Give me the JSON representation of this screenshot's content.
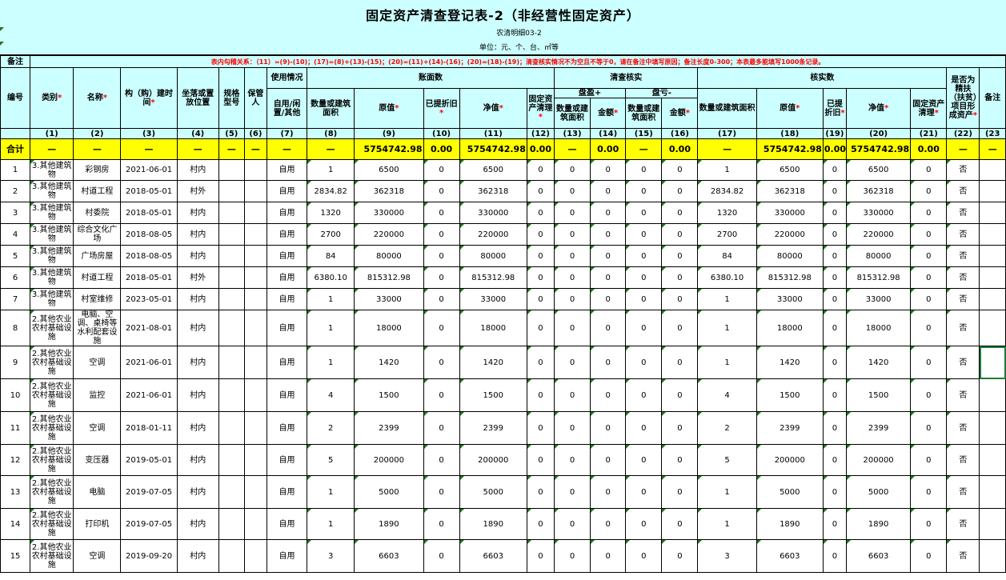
{
  "title": "固定资产清查登记表-2（非经营性固定资产）",
  "subcode": "农清明细03-2",
  "unit": "单位：元、个、台、㎡等",
  "note_label": "备注",
  "note_text": "表内勾稽关系：（11）=(9)-(10)；(17)=(8)+(13)-(15)；(20)=(11)+(14)-(16)；(20)=(18)-(19)；清查核实情况不为空且不等于0，请在备注中填写原因；备注长度0-300；本表最多能填写1000条记录。",
  "headers": {
    "no": "编号",
    "category": "类别",
    "name": "名称",
    "build_time": "构（购）建时间",
    "location": "坐落或置放位置",
    "spec": "规格型号",
    "keeper": "保管人",
    "usage_group": "使用情况",
    "usage": "自用/闲置/其他",
    "book_group": "账面数",
    "book_qty": "数量或建筑面积",
    "book_orig": "原值",
    "book_dep": "已提折旧",
    "book_net": "净值",
    "book_clear": "固定资产清理",
    "check_group": "清查核实",
    "surplus_group": "盘盈+",
    "surplus_qty": "数量或建筑面积",
    "surplus_amt": "金额",
    "loss_group": "盘亏-",
    "loss_qty": "数量或建筑面积",
    "loss_amt": "金额",
    "verified_group": "核实数",
    "ver_qty": "数量或建筑面积",
    "ver_orig": "原值",
    "ver_dep": "已提折旧",
    "ver_net": "净值",
    "ver_clear": "固定资产清理",
    "poverty": "是否为精扶（扶贫）项目形成资产",
    "remark": "备注"
  },
  "col_numbers": [
    "(1)",
    "(2)",
    "(3)",
    "(4)",
    "(5)",
    "(6)",
    "(7)",
    "(8)",
    "(9)",
    "(10)",
    "(11)",
    "(12)",
    "(13)",
    "(14)",
    "(15)",
    "(16)",
    "(17)",
    "(18)",
    "(19)",
    "(20)",
    "(21)",
    "(22)",
    "(23"
  ],
  "total": {
    "label": "合计",
    "dash": "—",
    "book_orig": "5754742.98",
    "book_dep": "0.00",
    "book_net": "5754742.98",
    "book_clear": "0.00",
    "surplus_amt": "0.00",
    "loss_amt": "0.00",
    "ver_orig": "5754742.98",
    "ver_dep": "0.00",
    "ver_net": "5754742.98",
    "ver_clear": "0.00"
  },
  "rows": [
    {
      "no": "1",
      "cat": "3.其他建筑物",
      "name": "彩钢房",
      "time": "2021-06-01",
      "loc": "村内",
      "usage": "自用",
      "qty": "1",
      "orig": "6500",
      "dep": "0",
      "net": "6500",
      "clear": "0",
      "sq": "0",
      "sa": "0",
      "lq": "0",
      "la": "0",
      "vq": "1",
      "vo": "6500",
      "vd": "0",
      "vn": "6500",
      "vc": "0",
      "pov": "否"
    },
    {
      "no": "2",
      "cat": "3.其他建筑物",
      "name": "村道工程",
      "time": "2018-05-01",
      "loc": "村外",
      "usage": "自用",
      "qty": "2834.82",
      "orig": "362318",
      "dep": "0",
      "net": "362318",
      "clear": "0",
      "sq": "0",
      "sa": "0",
      "lq": "0",
      "la": "0",
      "vq": "2834.82",
      "vo": "362318",
      "vd": "0",
      "vn": "362318",
      "vc": "0",
      "pov": "否"
    },
    {
      "no": "3",
      "cat": "3.其他建筑物",
      "name": "村委院",
      "time": "2018-05-01",
      "loc": "村内",
      "usage": "自用",
      "qty": "1320",
      "orig": "330000",
      "dep": "0",
      "net": "330000",
      "clear": "0",
      "sq": "0",
      "sa": "0",
      "lq": "0",
      "la": "0",
      "vq": "1320",
      "vo": "330000",
      "vd": "0",
      "vn": "330000",
      "vc": "0",
      "pov": "否"
    },
    {
      "no": "4",
      "cat": "3.其他建筑物",
      "name": "综合文化广场",
      "time": "2018-08-05",
      "loc": "村内",
      "usage": "自用",
      "qty": "2700",
      "orig": "220000",
      "dep": "0",
      "net": "220000",
      "clear": "0",
      "sq": "0",
      "sa": "0",
      "lq": "0",
      "la": "0",
      "vq": "2700",
      "vo": "220000",
      "vd": "0",
      "vn": "220000",
      "vc": "0",
      "pov": "否"
    },
    {
      "no": "5",
      "cat": "3.其他建筑物",
      "name": "广场房屋",
      "time": "2018-08-05",
      "loc": "村内",
      "usage": "自用",
      "qty": "84",
      "orig": "80000",
      "dep": "0",
      "net": "80000",
      "clear": "0",
      "sq": "0",
      "sa": "0",
      "lq": "0",
      "la": "0",
      "vq": "84",
      "vo": "80000",
      "vd": "0",
      "vn": "80000",
      "vc": "0",
      "pov": "否"
    },
    {
      "no": "6",
      "cat": "3.其他建筑物",
      "name": "村道工程",
      "time": "2018-05-01",
      "loc": "村外",
      "usage": "自用",
      "qty": "6380.10",
      "orig": "815312.98",
      "dep": "0",
      "net": "815312.98",
      "clear": "0",
      "sq": "0",
      "sa": "0",
      "lq": "0",
      "la": "0",
      "vq": "6380.10",
      "vo": "815312.98",
      "vd": "0",
      "vn": "815312.98",
      "vc": "0",
      "pov": "否"
    },
    {
      "no": "7",
      "cat": "3.其他建筑物",
      "name": "村室维修",
      "time": "2023-05-01",
      "loc": "村内",
      "usage": "自用",
      "qty": "1",
      "orig": "33000",
      "dep": "0",
      "net": "33000",
      "clear": "0",
      "sq": "0",
      "sa": "0",
      "lq": "0",
      "la": "0",
      "vq": "1",
      "vo": "33000",
      "vd": "0",
      "vn": "33000",
      "vc": "0",
      "pov": "否"
    },
    {
      "no": "8",
      "cat": "2.其他农业农村基础设施",
      "name": "电脑、空调、桌椅等水利配套设施",
      "time": "2021-08-01",
      "loc": "村内",
      "usage": "自用",
      "qty": "1",
      "orig": "18000",
      "dep": "0",
      "net": "18000",
      "clear": "0",
      "sq": "0",
      "sa": "0",
      "lq": "0",
      "la": "0",
      "vq": "1",
      "vo": "18000",
      "vd": "0",
      "vn": "18000",
      "vc": "0",
      "pov": "否"
    },
    {
      "no": "9",
      "cat": "2.其他农业农村基础设施",
      "name": "空调",
      "time": "2021-06-01",
      "loc": "村内",
      "usage": "自用",
      "qty": "1",
      "orig": "1420",
      "dep": "0",
      "net": "1420",
      "clear": "0",
      "sq": "0",
      "sa": "0",
      "lq": "0",
      "la": "0",
      "vq": "1",
      "vo": "1420",
      "vd": "0",
      "vn": "1420",
      "vc": "0",
      "pov": "否"
    },
    {
      "no": "10",
      "cat": "2.其他农业农村基础设施",
      "name": "监控",
      "time": "2021-06-01",
      "loc": "村内",
      "usage": "自用",
      "qty": "4",
      "orig": "1500",
      "dep": "0",
      "net": "1500",
      "clear": "0",
      "sq": "0",
      "sa": "0",
      "lq": "0",
      "la": "0",
      "vq": "4",
      "vo": "1500",
      "vd": "0",
      "vn": "1500",
      "vc": "0",
      "pov": "否"
    },
    {
      "no": "11",
      "cat": "2.其他农业农村基础设施",
      "name": "空调",
      "time": "2018-01-11",
      "loc": "村内",
      "usage": "自用",
      "qty": "2",
      "orig": "2399",
      "dep": "0",
      "net": "2399",
      "clear": "0",
      "sq": "0",
      "sa": "0",
      "lq": "0",
      "la": "0",
      "vq": "2",
      "vo": "2399",
      "vd": "0",
      "vn": "2399",
      "vc": "0",
      "pov": "否"
    },
    {
      "no": "12",
      "cat": "2.其他农业农村基础设施",
      "name": "变压器",
      "time": "2019-05-01",
      "loc": "村内",
      "usage": "自用",
      "qty": "5",
      "orig": "200000",
      "dep": "0",
      "net": "200000",
      "clear": "0",
      "sq": "0",
      "sa": "0",
      "lq": "0",
      "la": "0",
      "vq": "5",
      "vo": "200000",
      "vd": "0",
      "vn": "200000",
      "vc": "0",
      "pov": "否"
    },
    {
      "no": "13",
      "cat": "2.其他农业农村基础设施",
      "name": "电脑",
      "time": "2019-07-05",
      "loc": "村内",
      "usage": "自用",
      "qty": "1",
      "orig": "5000",
      "dep": "0",
      "net": "5000",
      "clear": "0",
      "sq": "0",
      "sa": "0",
      "lq": "0",
      "la": "0",
      "vq": "1",
      "vo": "5000",
      "vd": "0",
      "vn": "5000",
      "vc": "0",
      "pov": "否"
    },
    {
      "no": "14",
      "cat": "2.其他农业农村基础设施",
      "name": "打印机",
      "time": "2019-07-05",
      "loc": "村内",
      "usage": "自用",
      "qty": "1",
      "orig": "1890",
      "dep": "0",
      "net": "1890",
      "clear": "0",
      "sq": "0",
      "sa": "0",
      "lq": "0",
      "la": "0",
      "vq": "1",
      "vo": "1890",
      "vd": "0",
      "vn": "1890",
      "vc": "0",
      "pov": "否"
    },
    {
      "no": "15",
      "cat": "2.其他农业农村基础设施",
      "name": "空调",
      "time": "2019-09-20",
      "loc": "村内",
      "usage": "自用",
      "qty": "3",
      "orig": "6603",
      "dep": "0",
      "net": "6603",
      "clear": "0",
      "sq": "0",
      "sa": "0",
      "lq": "0",
      "la": "0",
      "vq": "3",
      "vo": "6603",
      "vd": "0",
      "vn": "6603",
      "vc": "0",
      "pov": "否"
    }
  ]
}
